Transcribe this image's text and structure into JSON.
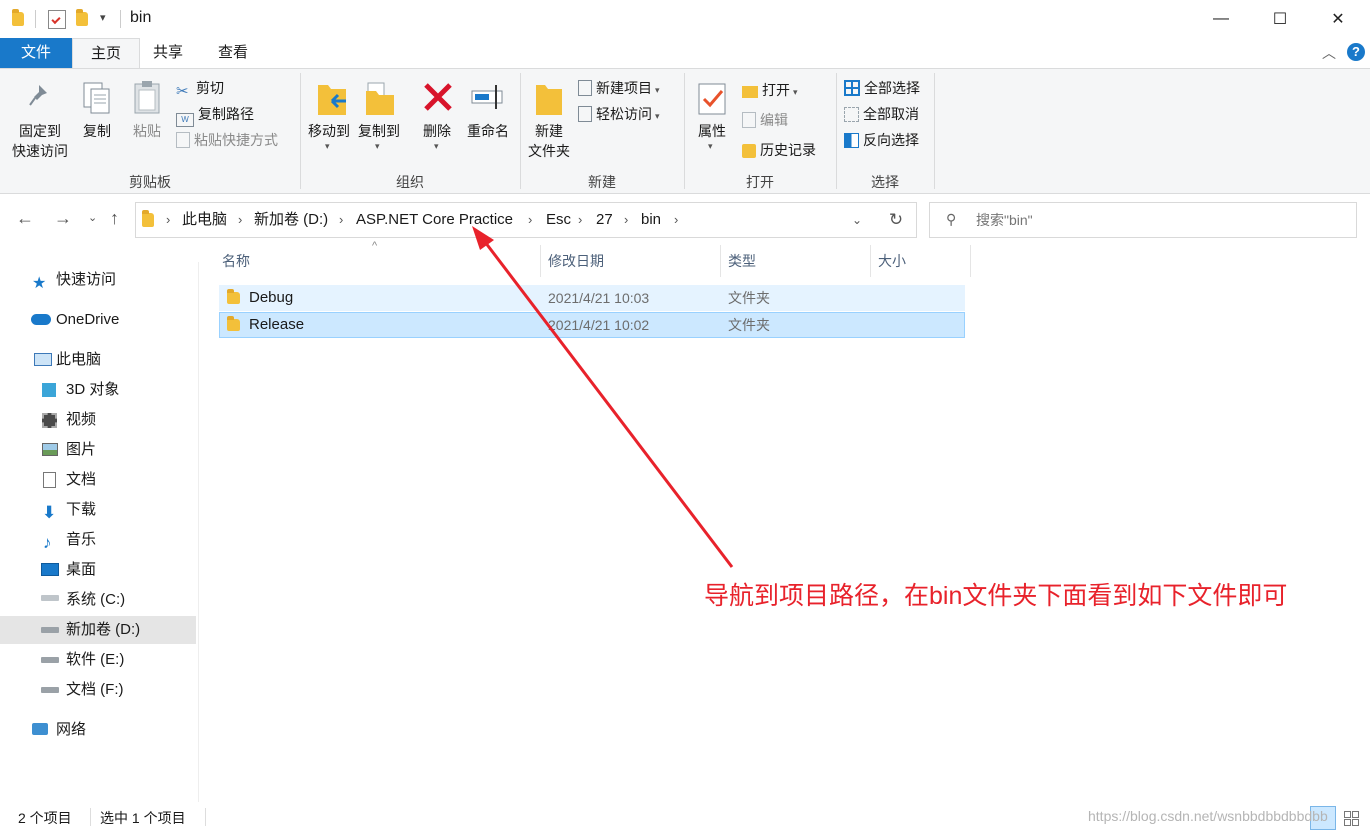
{
  "window": {
    "title": "bin",
    "minimize": "—",
    "maximize": "☐",
    "close": "✕"
  },
  "tabs": {
    "file": "文件",
    "home": "主页",
    "share": "共享",
    "view": "查看"
  },
  "ribbon": {
    "clipboard": {
      "label": "剪贴板",
      "pin_line1": "固定到",
      "pin_line2": "快速访问",
      "copy": "复制",
      "paste": "粘贴",
      "cut": "剪切",
      "copy_path": "复制路径",
      "paste_shortcut": "粘贴快捷方式"
    },
    "organize": {
      "label": "组织",
      "move_to": "移动到",
      "copy_to": "复制到",
      "delete": "删除",
      "rename": "重命名"
    },
    "new": {
      "label": "新建",
      "new_folder_line1": "新建",
      "new_folder_line2": "文件夹",
      "new_item": "新建项目",
      "easy_access": "轻松访问"
    },
    "open": {
      "label": "打开",
      "properties": "属性",
      "open": "打开",
      "edit": "编辑",
      "history": "历史记录"
    },
    "select": {
      "label": "选择",
      "select_all": "全部选择",
      "select_none": "全部取消",
      "invert": "反向选择"
    }
  },
  "address": {
    "crumbs": [
      "此电脑",
      "新加卷 (D:)",
      "ASP.NET Core Practice",
      "Esc",
      "27",
      "bin"
    ],
    "search_placeholder": "搜索\"bin\""
  },
  "sidebar": {
    "quick_access": "快速访问",
    "onedrive": "OneDrive",
    "this_pc": "此电脑",
    "objects3d": "3D 对象",
    "videos": "视频",
    "pictures": "图片",
    "documents": "文档",
    "downloads": "下载",
    "music": "音乐",
    "desktop": "桌面",
    "drive_c": "系统 (C:)",
    "drive_d": "新加卷 (D:)",
    "drive_e": "软件 (E:)",
    "drive_f": "文档 (F:)",
    "network": "网络"
  },
  "columns": {
    "name": "名称",
    "modified": "修改日期",
    "type": "类型",
    "size": "大小"
  },
  "files": [
    {
      "name": "Debug",
      "modified": "2021/4/21 10:03",
      "type": "文件夹"
    },
    {
      "name": "Release",
      "modified": "2021/4/21 10:02",
      "type": "文件夹"
    }
  ],
  "status": {
    "count": "2 个项目",
    "selected": "选中 1 个项目"
  },
  "annotation": "导航到项目路径，在bin文件夹下面看到如下文件即可",
  "watermark": "https://blog.csdn.net/wsnbbdbbdbbdbb",
  "colors": {
    "accent": "#1979ca",
    "folder": "#f3c03a",
    "selected": "#cce8ff",
    "annotation": "#e8222b"
  }
}
